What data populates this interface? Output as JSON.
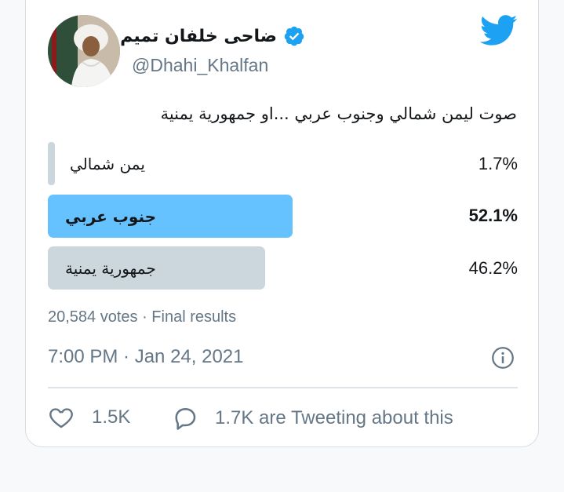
{
  "tweet": {
    "display_name": "ضاحى خلفان تميم",
    "handle": "@Dhahi_Khalfan",
    "text": "صوت ليمن شمالي وجنوب عربي  ...او جمهورية يمنية"
  },
  "poll": {
    "options": [
      {
        "label": "يمن شمالي",
        "percent": "1.7%",
        "fraction": 0.017,
        "winner": false
      },
      {
        "label": "جنوب عربي",
        "percent": "52.1%",
        "fraction": 0.521,
        "winner": true
      },
      {
        "label": "جمهورية يمنية",
        "percent": "46.2%",
        "fraction": 0.462,
        "winner": false
      }
    ],
    "summary": "20,584 votes · Final results"
  },
  "timestamp": "7:00 PM · Jan 24, 2021",
  "actions": {
    "likes": "1.5K",
    "tweeting": "1.7K are Tweeting about this"
  },
  "colors": {
    "winner_bar": "#66c2ff",
    "other_bar": "#ccd6dd",
    "twitter_blue": "#1da1f2",
    "secondary_text": "#657786"
  },
  "icons": {
    "logo": "twitter-bird-icon",
    "verified": "verified-badge-icon",
    "info": "info-icon",
    "like": "heart-icon",
    "reply": "speech-bubble-icon"
  }
}
